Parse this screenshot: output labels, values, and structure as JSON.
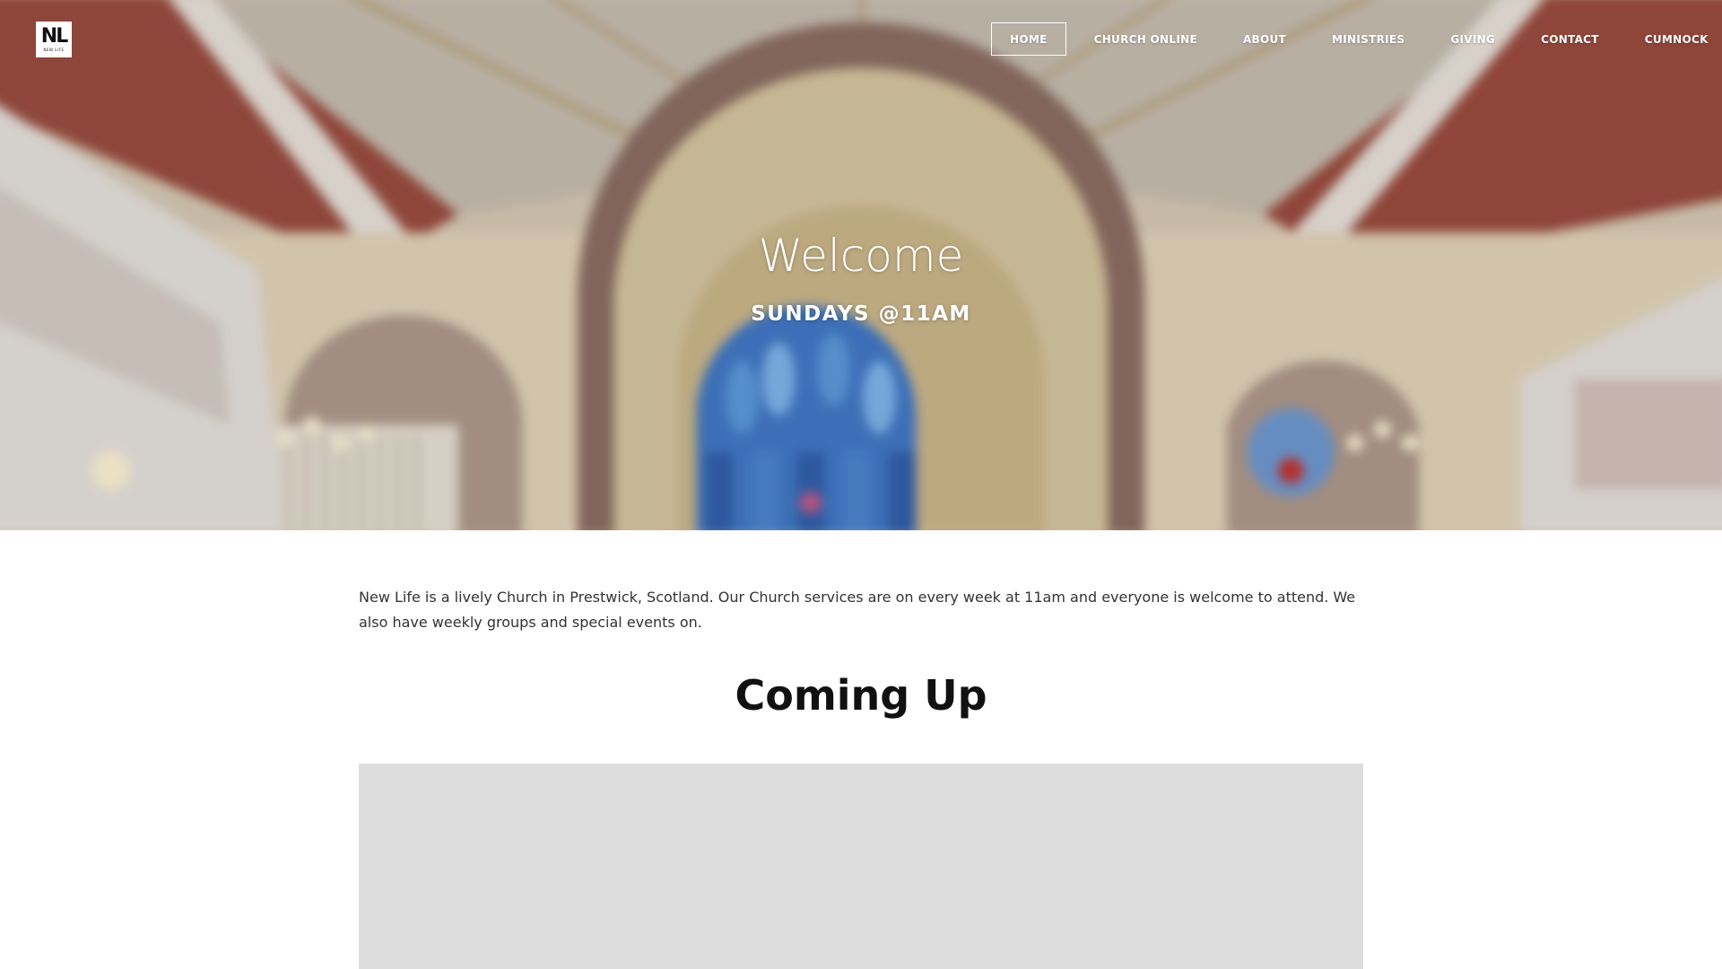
{
  "site": {
    "logo_text": "NL",
    "logo_subtext": "NEW LIFE"
  },
  "nav": {
    "items": [
      {
        "label": "HOME",
        "active": true
      },
      {
        "label": "CHURCH ONLINE",
        "active": false
      },
      {
        "label": "ABOUT",
        "active": false
      },
      {
        "label": "MINISTRIES",
        "active": false
      },
      {
        "label": "GIVING",
        "active": false
      },
      {
        "label": "CONTACT",
        "active": false
      },
      {
        "label": "CUMNOCK",
        "active": false
      }
    ]
  },
  "hero": {
    "title": "Welcome",
    "subtitle": "SUNDAYS @11AM"
  },
  "main": {
    "intro": "New Life is a lively Church in Prestwick, Scotland. Our Church services are on every week at 11am and everyone is welcome to attend. We also have weekly groups and special events on.",
    "section_title": "Coming Up"
  },
  "colors": {
    "nav_text": "#ffffff",
    "body_text": "#333333",
    "heading": "#111111",
    "placeholder": "#dddddd"
  }
}
